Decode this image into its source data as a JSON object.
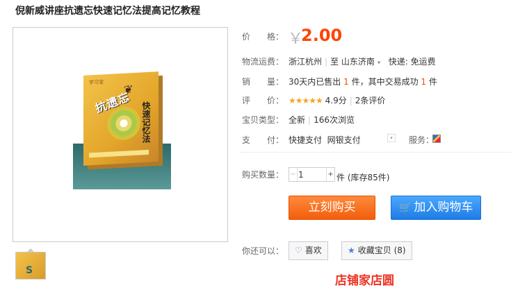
{
  "title": "倪新威讲座抗遗忘快速记忆法提高记忆教程",
  "product_image": {
    "box_logo": "学习宝",
    "box_title": "抗遗忘",
    "box_subtitle": "快速记忆法"
  },
  "price": {
    "label": "价　　格：",
    "currency": "￥",
    "amount": "2.00"
  },
  "shipping": {
    "label": "物流运费：",
    "from": "浙江杭州",
    "to_prefix": "至",
    "to": "山东济南",
    "fee": "快递: 免运费"
  },
  "sales": {
    "label": "销　　量：",
    "prefix": "30天内已售出",
    "sold": "1",
    "unit1": "件，其中交易成功",
    "success": "1",
    "unit2": "件"
  },
  "rating": {
    "label": "评　　价：",
    "stars": "★★★★★",
    "score": "4.9分",
    "reviews": "2条评价"
  },
  "type": {
    "label": "宝贝类型：",
    "condition": "全新",
    "views": "166次浏览"
  },
  "payment": {
    "label": "支　　付：",
    "methods": [
      "快捷支付",
      "网银支付"
    ],
    "service_label": "服务："
  },
  "quantity": {
    "label": "购买数量：",
    "value": "1",
    "stock": "件 (库存85件)"
  },
  "buttons": {
    "buy": "立刻购买",
    "cart": "加入购物车"
  },
  "also": {
    "label": "你还可以：",
    "like": "喜欢",
    "favorite": "收藏宝贝 (8)"
  },
  "thumbnail_text": "S",
  "cutoff_text": "店铺家店圆",
  "colors": {
    "accent": "#ff4400",
    "buy": "#f25e0d",
    "cart": "#1e7ce6"
  }
}
